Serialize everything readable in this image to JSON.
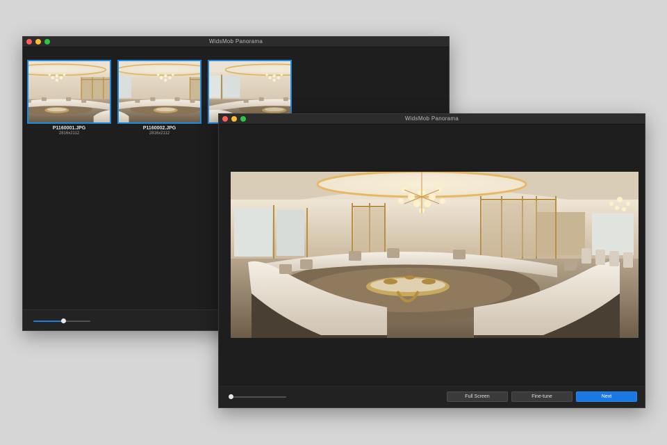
{
  "window1": {
    "title": "WidsMob Panorama",
    "thumbnails": [
      {
        "name": "P1160001.JPG",
        "dimensions": "2816x2112"
      },
      {
        "name": "P1160002.JPG",
        "dimensions": "2816x2112"
      },
      {
        "name": "",
        "dimensions": ""
      }
    ],
    "thumbnail_size_slider": {
      "value": 0.52
    }
  },
  "window2": {
    "title": "WidsMob Panorama",
    "zoom_slider": {
      "value": 0.0
    },
    "buttons": {
      "full_screen": "Full Screen",
      "fine_tune": "Fine-tune",
      "next": "Next"
    }
  },
  "colors": {
    "accent": "#1b78e2",
    "selection_border": "#1c89e3",
    "window_background": "#1e1e1e",
    "desktop_background": "#d6d6d6"
  }
}
